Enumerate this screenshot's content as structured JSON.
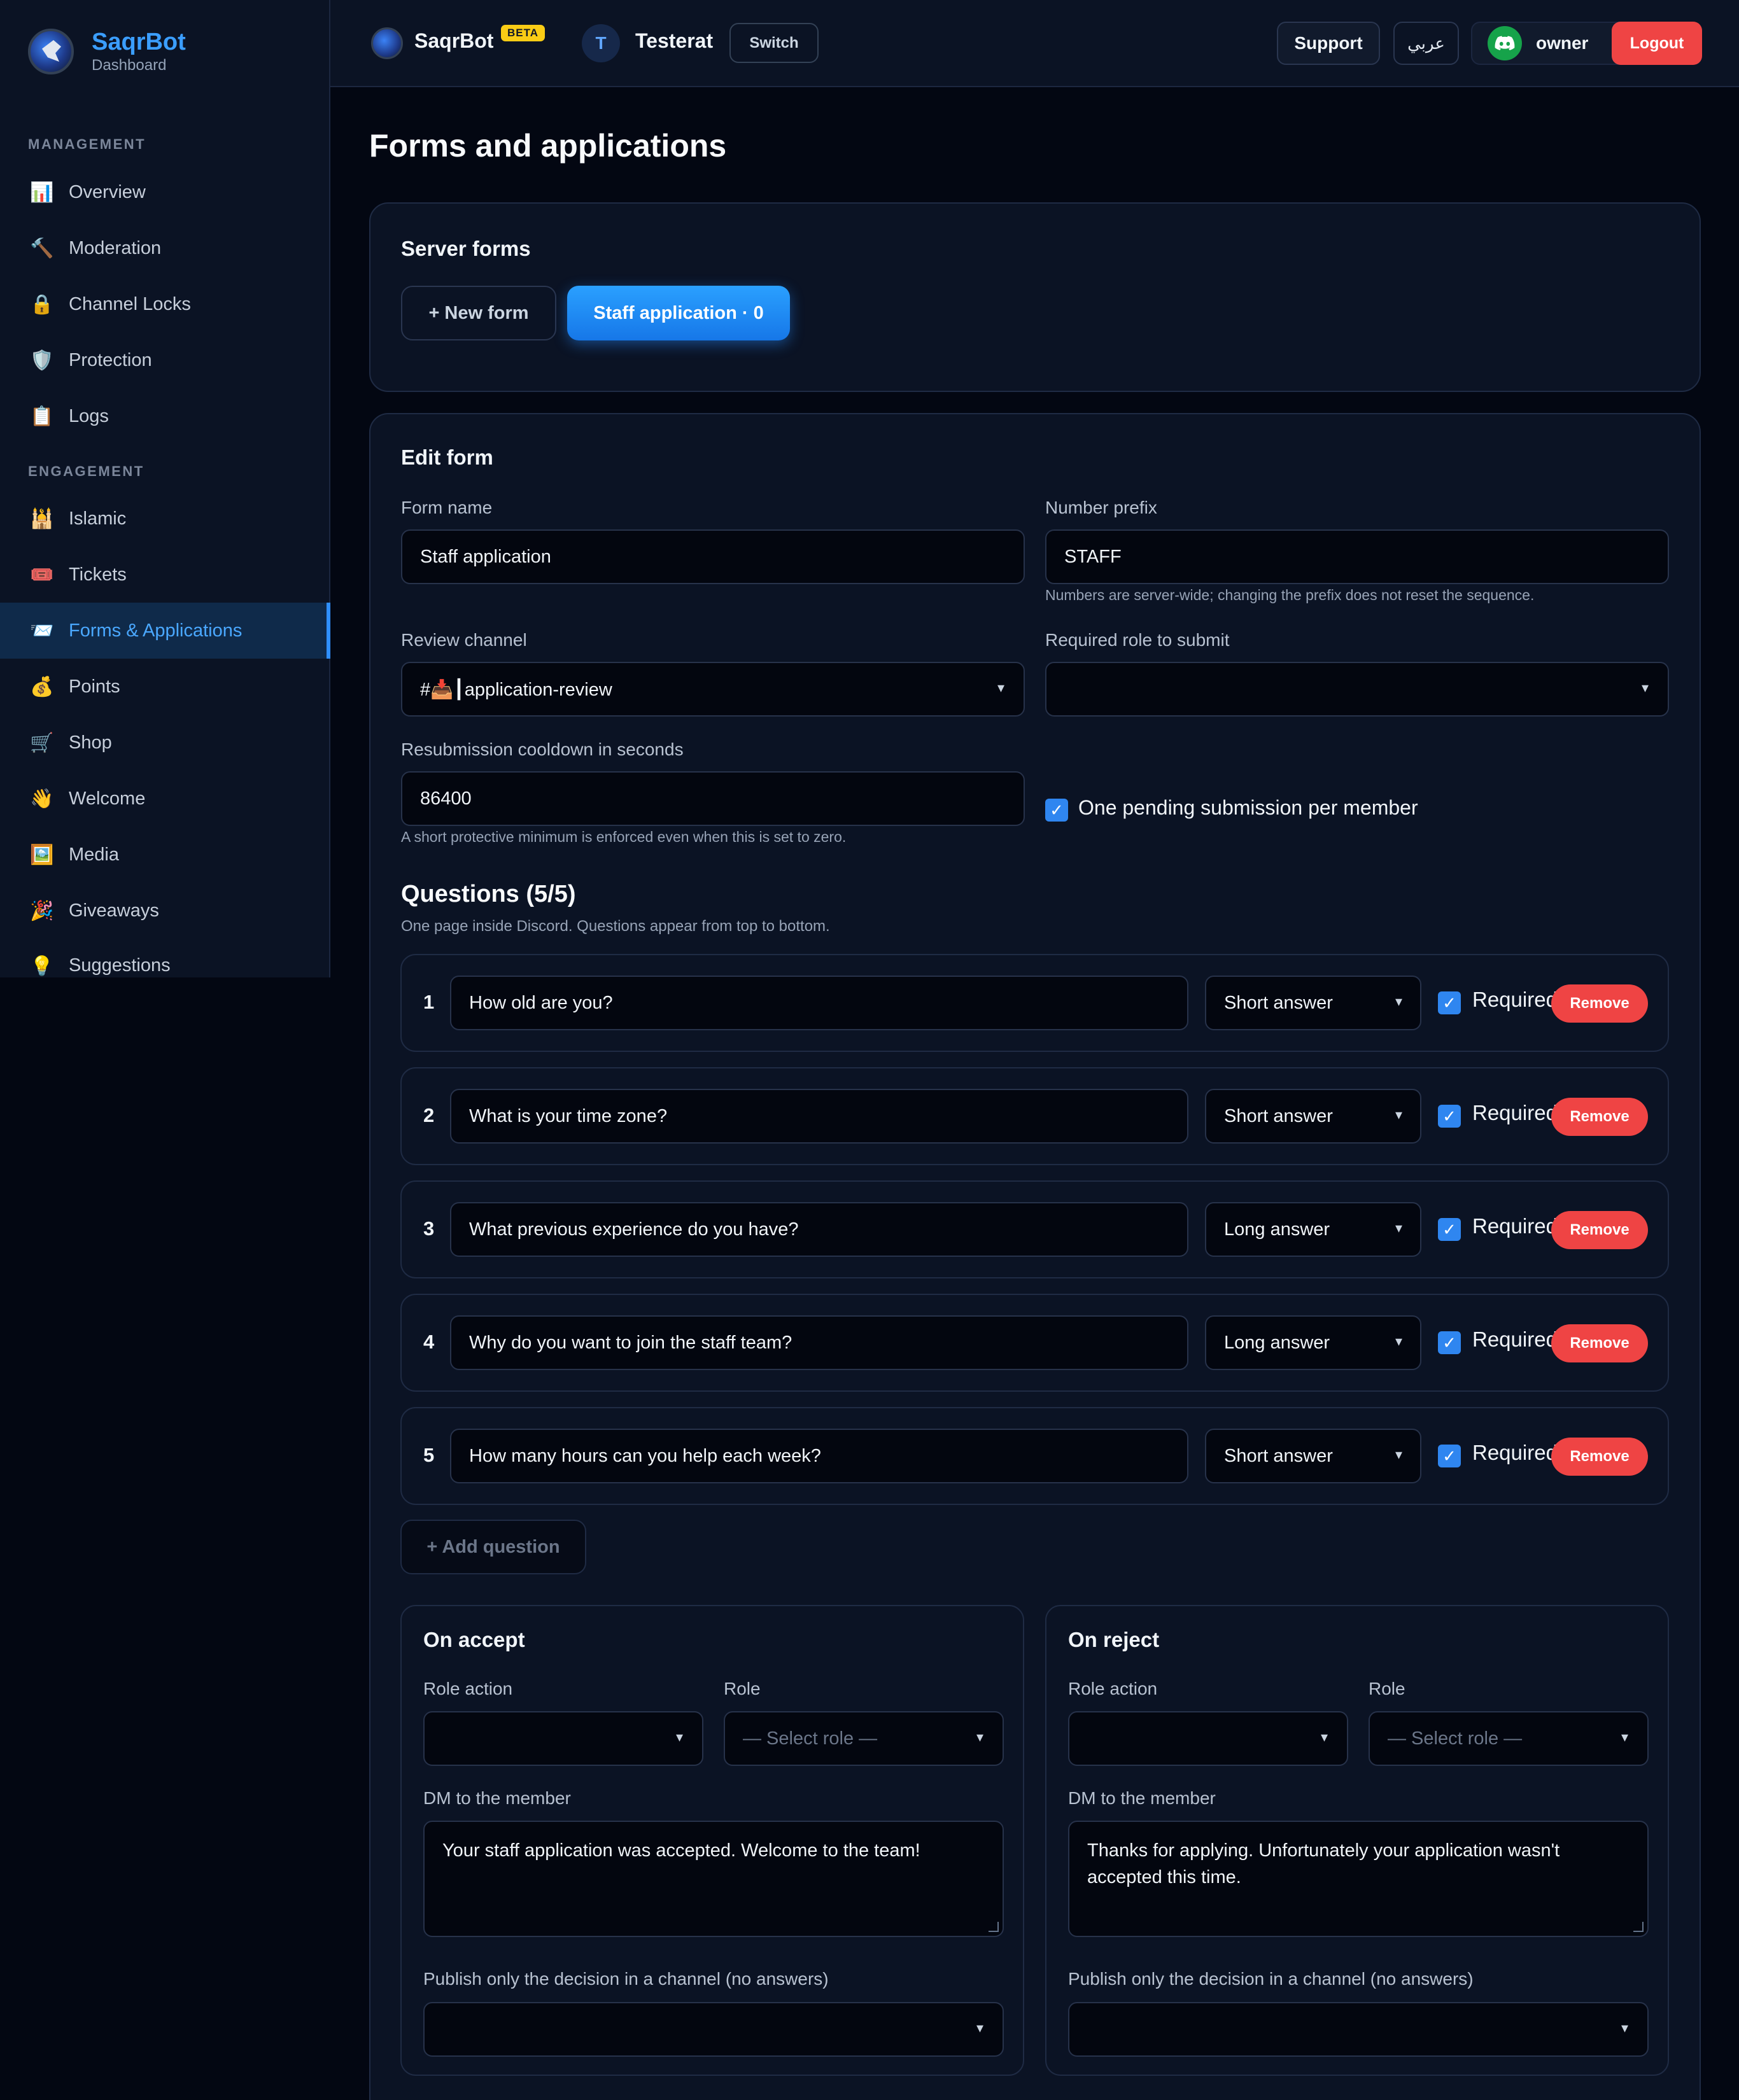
{
  "sidebar": {
    "brand_name": "SaqrBot",
    "brand_sub": "Dashboard",
    "sections": [
      "MANAGEMENT",
      "ENGAGEMENT"
    ],
    "items": [
      {
        "label": "Overview",
        "icon": "📊"
      },
      {
        "label": "Moderation",
        "icon": "🔨"
      },
      {
        "label": "Channel Locks",
        "icon": "🔒"
      },
      {
        "label": "Protection",
        "icon": "🛡️"
      },
      {
        "label": "Logs",
        "icon": "📋"
      },
      {
        "label": "Islamic",
        "icon": "🕌"
      },
      {
        "label": "Tickets",
        "icon": "🎟️"
      },
      {
        "label": "Forms & Applications",
        "icon": "📨"
      },
      {
        "label": "Points",
        "icon": "💰"
      },
      {
        "label": "Shop",
        "icon": "🛒"
      },
      {
        "label": "Welcome",
        "icon": "👋"
      },
      {
        "label": "Media",
        "icon": "🖼️"
      },
      {
        "label": "Giveaways",
        "icon": "🎉"
      },
      {
        "label": "Suggestions",
        "icon": "💡"
      }
    ]
  },
  "topbar": {
    "bot_name": "SaqrBot",
    "beta": "BETA",
    "server_initial": "T",
    "server_name": "Testerat",
    "switch": "Switch",
    "support": "Support",
    "language": "عربي",
    "user": "owner",
    "logout": "Logout"
  },
  "page_title": "Forms and applications",
  "server_forms": {
    "title": "Server forms",
    "new_form": "+ New form",
    "active_form": "Staff application · 0"
  },
  "edit_form": {
    "title": "Edit form",
    "form_name_label": "Form name",
    "form_name_value": "Staff application",
    "prefix_label": "Number prefix",
    "prefix_value": "STAFF",
    "prefix_hint": "Numbers are server-wide; changing the prefix does not reset the sequence.",
    "review_label": "Review channel",
    "review_value": "#📥┃application-review",
    "role_label": "Required role to submit",
    "role_value": "",
    "cooldown_label": "Resubmission cooldown in seconds",
    "cooldown_value": "86400",
    "cooldown_hint": "A short protective minimum is enforced even when this is set to zero.",
    "one_pending_label": "One pending submission per member",
    "one_pending_checked": true
  },
  "questions": {
    "title": "Questions (5/5)",
    "subtitle": "One page inside Discord. Questions appear from top to bottom.",
    "required_label": "Required",
    "remove_label": "Remove",
    "add_label": "+ Add question",
    "items": [
      {
        "num": "1",
        "text": "How old are you?",
        "type": "Short answer",
        "required": true
      },
      {
        "num": "2",
        "text": "What is your time zone?",
        "type": "Short answer",
        "required": true
      },
      {
        "num": "3",
        "text": "What previous experience do you have?",
        "type": "Long answer",
        "required": true
      },
      {
        "num": "4",
        "text": "Why do you want to join the staff team?",
        "type": "Long answer",
        "required": true
      },
      {
        "num": "5",
        "text": "How many hours can you help each week?",
        "type": "Short answer",
        "required": true
      }
    ]
  },
  "on_accept": {
    "title": "On accept",
    "role_action_label": "Role action",
    "role_action_value": "",
    "role_label": "Role",
    "role_placeholder": "— Select role —",
    "dm_label": "DM to the member",
    "dm_value": "Your staff application was accepted. Welcome to the team!",
    "publish_label": "Publish only the decision in a channel (no answers)",
    "publish_value": ""
  },
  "on_reject": {
    "title": "On reject",
    "role_action_label": "Role action",
    "role_action_value": "",
    "role_label": "Role",
    "role_placeholder": "— Select role —",
    "dm_label": "DM to the member",
    "dm_value": "Thanks for applying. Unfortunately your application wasn't accepted this time.",
    "publish_label": "Publish only the decision in a channel (no answers)",
    "publish_value": ""
  },
  "colors": {
    "accent": "#2f8fff",
    "danger": "#ef4444",
    "beta": "#facc15",
    "background": "#030712",
    "panel": "#0b1324"
  }
}
